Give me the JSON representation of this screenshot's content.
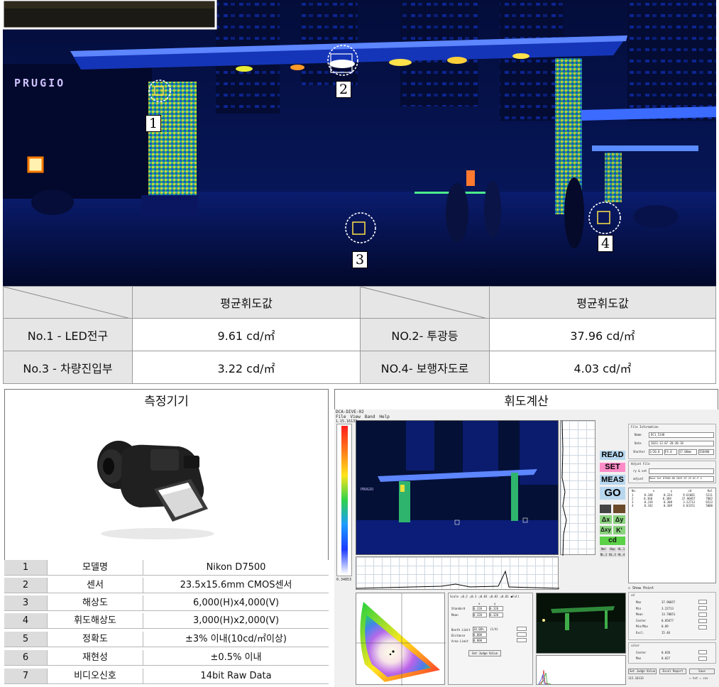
{
  "hero": {
    "sign_text": "PRUGIO",
    "markers": [
      "1",
      "2",
      "3",
      "4"
    ]
  },
  "luminance_table": {
    "header_left": "평균휘도값",
    "header_right": "평균휘도값",
    "rows": [
      {
        "left_label": "No.1 - LED전구",
        "left_value": "9.61 cd/㎡",
        "right_label": "NO.2- 투광등",
        "right_value": "37.96 cd/㎡"
      },
      {
        "left_label": "No.3 - 차량진입부",
        "left_value": "3.22 cd/㎡",
        "right_label": "NO.4- 보행자도로",
        "right_value": "4.03 cd/㎡"
      }
    ]
  },
  "device_panel": {
    "title": "측정기기",
    "specs": [
      {
        "no": "1",
        "name": "모델명",
        "value": "Nikon D7500"
      },
      {
        "no": "2",
        "name": "센서",
        "value": "23.5x15.6mm CMOS센서"
      },
      {
        "no": "3",
        "name": "해상도",
        "value": "6,000(H)x4,000(V)"
      },
      {
        "no": "4",
        "name": "휘도해상도",
        "value": "3,000(H)x2,000(V)"
      },
      {
        "no": "5",
        "name": "정확도",
        "value": "±3% 이내(10cd/㎡이상)"
      },
      {
        "no": "6",
        "name": "재현성",
        "value": "±0.5% 이내"
      },
      {
        "no": "7",
        "name": "비디오신호",
        "value": "14bit Raw Data"
      }
    ]
  },
  "calc_panel": {
    "title": "휘도계산",
    "software": {
      "window_title": "DCA-DIVE-02",
      "menu": [
        "File",
        "View",
        "Band",
        "Help"
      ],
      "scale_top": "1.15.16133",
      "scale_bottom": "0.34853",
      "buttons": {
        "read": "READ",
        "set": "SET",
        "meas": "MEAS",
        "go": "GO",
        "dx": "Δx",
        "dy": "Δy",
        "dxy": "Δxy",
        "k": "K'",
        "cd": "cd"
      },
      "mini_buttons": [
        "Nmr",
        "Nap",
        "HL.1",
        "NL.2",
        "NL.3",
        "HL.4"
      ],
      "file_info": {
        "title": "File Information",
        "name_label": "Name",
        "name_value": "DC1_5148",
        "date_label": "Date",
        "date_value": "2023.12.07 20:38:18",
        "shutter_label": "Shutter",
        "shutter_value": "1/20.0",
        "f_value": "F4.0",
        "focal_value": "17.00mm",
        "iso_value": "ISO400"
      },
      "adjust_file": {
        "title": "Adjust File",
        "label1": "ry & set",
        "label2": "adjust",
        "value2": "Base Set D7500-00 2023 07 23 OC-P 4"
      },
      "measure_table": {
        "headers": [
          "No.",
          "x",
          "y",
          "cd",
          "Kal"
        ],
        "rows": [
          [
            "1",
            "0.348",
            "0.334",
            "9.61081",
            "5211"
          ],
          [
            "2",
            "0.360",
            "0.389",
            "37.96057",
            "7882"
          ],
          [
            "3",
            "0.319",
            "0.308",
            "3.22713",
            "6523"
          ],
          [
            "4",
            "0.342",
            "0.309",
            "4.03151",
            "5000"
          ]
        ]
      },
      "show_point": "Show Point",
      "cd_group": {
        "title": "cd",
        "rows": [
          [
            "Max",
            "37.96057"
          ],
          [
            "Min",
            "3.22713"
          ],
          [
            "Mean",
            "13.70051"
          ],
          [
            "Center",
            "0.05677"
          ],
          [
            "Min/Max",
            "0.09"
          ],
          [
            "Excl.",
            "15.46"
          ]
        ]
      },
      "color_group": {
        "title": "color",
        "rows": [
          [
            "Center",
            "0.020"
          ],
          [
            "Max",
            "0.027"
          ]
        ]
      },
      "bottom_buttons": [
        "Set Judge Value",
        "Excel Report",
        "Save"
      ],
      "bottom_checks": [
        "txt",
        "csv"
      ],
      "status": "115.16133",
      "scale_options": [
        "Scale",
        "0.2",
        "0.3",
        "0.03",
        "0.02",
        "0.01",
        "Full"
      ],
      "xy_headers": [
        "x",
        "y"
      ],
      "standard_label": "Standard",
      "standard_x": "0.320",
      "standard_y": "0.320",
      "mean_label": "Mean",
      "mean_x": "0.320",
      "mean_y": "0.320",
      "judge_labels": [
        "Booth Limit",
        "Distance",
        "Area Limit"
      ],
      "judge_values": [
        "20.00%",
        "0.000",
        "0.000"
      ],
      "judge_unit": "(1/4)",
      "set_judge_button": "Set Judge Value"
    }
  }
}
